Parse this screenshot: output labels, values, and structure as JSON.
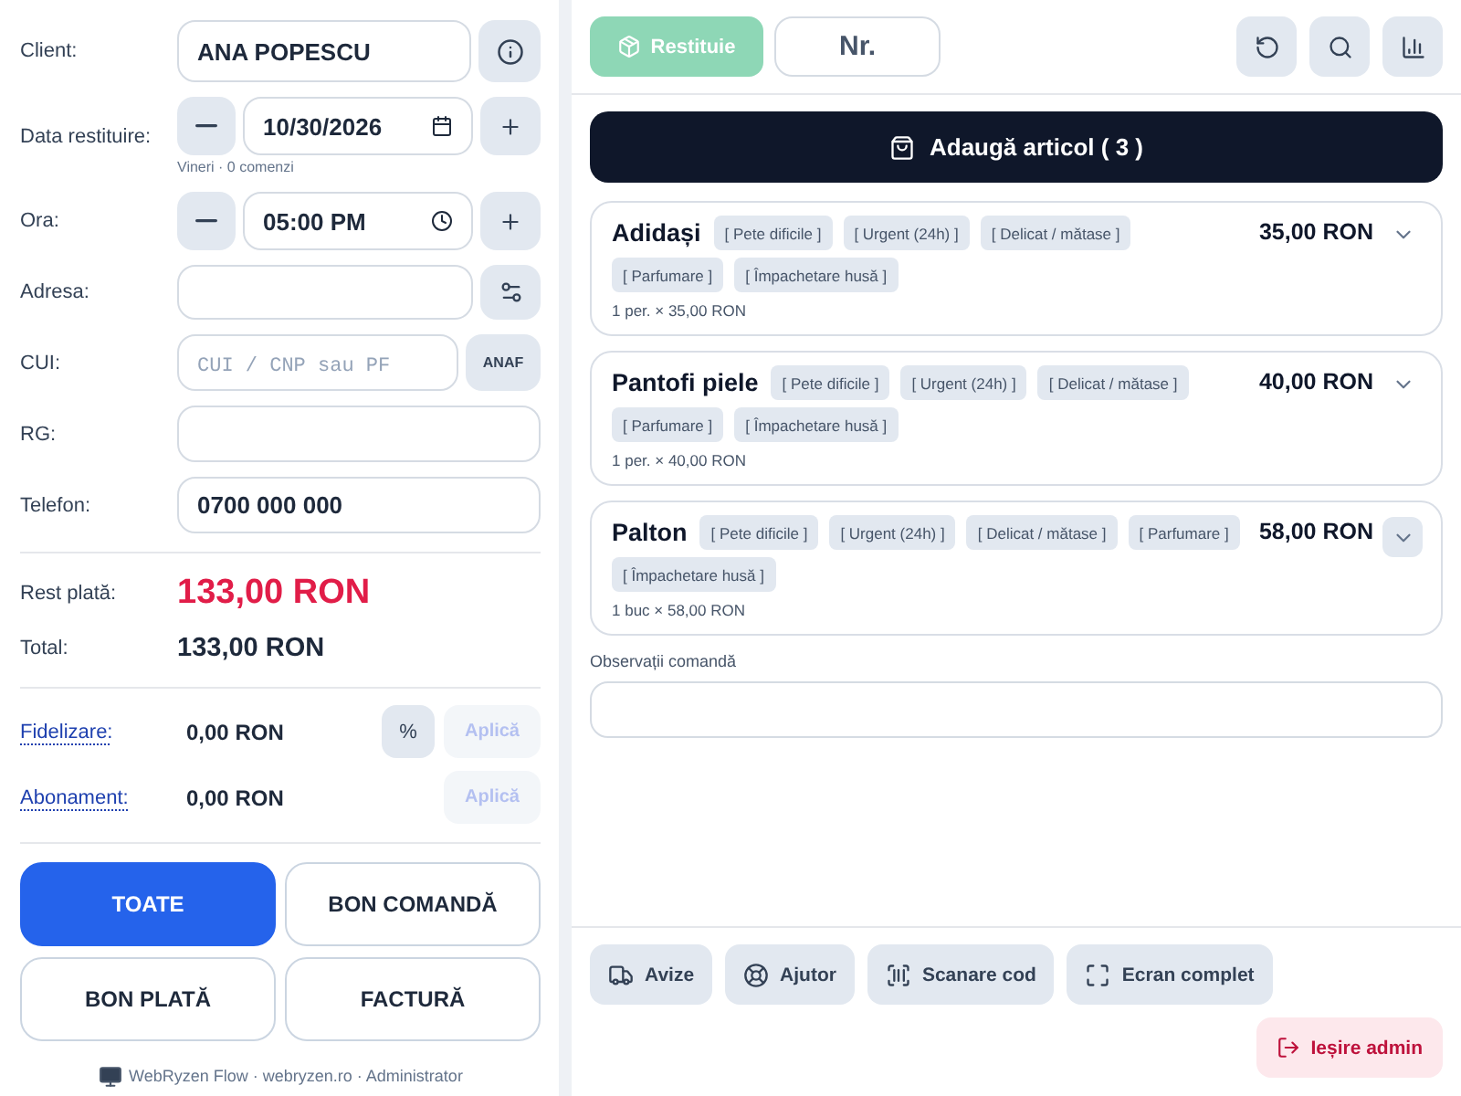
{
  "form": {
    "client": {
      "label": "Client:",
      "value": "ANA POPESCU"
    },
    "return_date": {
      "label": "Data restituire:",
      "value": "10/30/2026",
      "hint": "Vineri · 0 comenzi"
    },
    "time": {
      "label": "Ora:",
      "value": "05:00 PM"
    },
    "address": {
      "label": "Adresa:"
    },
    "tax_id": {
      "label": "CUI:",
      "placeholder": "CUI / CNP sau PF",
      "button": "ANAF"
    },
    "registry": {
      "label": "RG:"
    },
    "phone": {
      "label": "Telefon:",
      "value": "0700 000 000"
    }
  },
  "totals": [
    {
      "kind": "due",
      "label": "Rest plată:",
      "value": "133,00 RON"
    },
    {
      "kind": "total",
      "label": "Total:",
      "value": "133,00 RON"
    }
  ],
  "discounts": [
    {
      "label": "Fidelizare:",
      "value": "0,00 RON",
      "percent_button": "%",
      "apply_button": "Aplică",
      "disabled": true
    },
    {
      "label": "Abonament:",
      "value": "0,00 RON",
      "apply_button": "Aplică",
      "disabled": true
    }
  ],
  "print_options": [
    {
      "label": "TOATE",
      "selected": true
    },
    {
      "label": "BON COMANDĂ",
      "selected": false
    },
    {
      "label": "BON PLATĂ",
      "selected": false
    },
    {
      "label": "FACTURĂ",
      "selected": false
    }
  ],
  "footer": "WebRyzen Flow · webryzen.ro · Administrator",
  "toolbar": {
    "mode_button": {
      "label": "Restituie",
      "disabled": true
    },
    "number_field": {
      "placeholder": "Nr."
    }
  },
  "add_button": "Adaugă articol ( 3 )",
  "items": [
    {
      "name": "Adidași",
      "tags": [
        "[ Pete dificile ]",
        "[ Urgent (24h) ]",
        "[ Delicat / mătase ]",
        "[ Parfumare ]",
        "[ Împachetare husă ]"
      ],
      "price": "35,00 RON",
      "detail": "1 per. × 35,00 RON",
      "focused": false
    },
    {
      "name": "Pantofi piele",
      "tags": [
        "[ Pete dificile ]",
        "[ Urgent (24h) ]",
        "[ Delicat / mătase ]",
        "[ Parfumare ]",
        "[ Împachetare husă ]"
      ],
      "price": "40,00 RON",
      "detail": "1 per. × 40,00 RON",
      "focused": false
    },
    {
      "name": "Palton",
      "tags": [
        "[ Pete dificile ]",
        "[ Urgent (24h) ]",
        "[ Delicat / mătase ]",
        "[ Parfumare ]",
        "[ Împachetare husă ]"
      ],
      "price": "58,00 RON",
      "detail": "1 buc × 58,00 RON",
      "focused": true
    }
  ],
  "notes": {
    "label": "Observații comandă"
  },
  "actions": [
    "Avize",
    "Ajutor",
    "Scanare cod",
    "Ecran complet"
  ],
  "logout_button": "Ieșire admin"
}
